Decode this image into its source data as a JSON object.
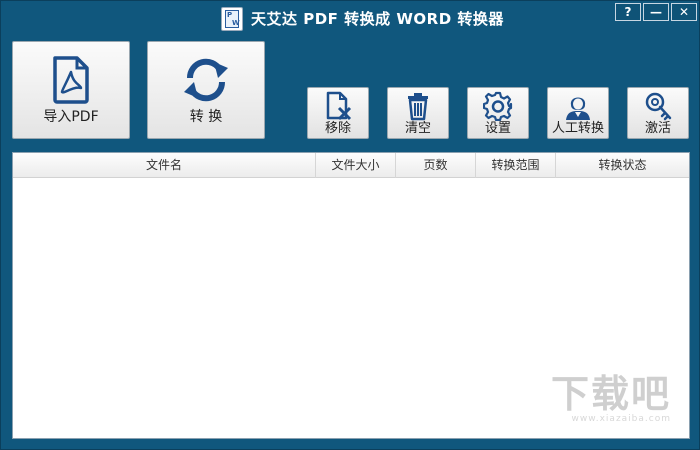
{
  "window": {
    "title": "天艾达 PDF 转换成 WORD 转换器",
    "controls": {
      "help": "?",
      "minimize": "—",
      "close": "✕"
    }
  },
  "toolbar": {
    "import_label": "导入PDF",
    "convert_label": "转 换",
    "remove_label": "移除",
    "clear_label": "清空",
    "settings_label": "设置",
    "manual_label": "人工转换",
    "activate_label": "激活"
  },
  "icons": {
    "import": "pdf-file-icon",
    "convert": "refresh-icon",
    "remove": "file-remove-icon",
    "clear": "trash-icon",
    "settings": "gear-icon",
    "manual": "person-icon",
    "activate": "key-icon"
  },
  "file_list": {
    "columns": [
      "文件名",
      "文件大小",
      "页数",
      "转换范围",
      "转换状态"
    ],
    "rows": []
  },
  "watermark": {
    "text": "下载吧",
    "sub": "www.xiazaiba.com"
  },
  "colors": {
    "frame": "#10577d",
    "icon_blue": "#1e4f8c"
  }
}
